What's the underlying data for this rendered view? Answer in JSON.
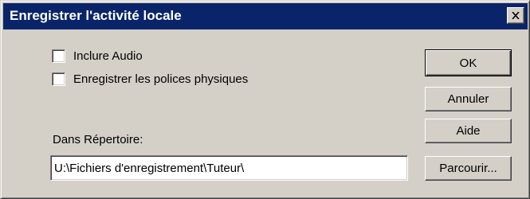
{
  "window": {
    "title": "Enregistrer l'activité locale",
    "close_icon": "close-icon"
  },
  "options": {
    "include_audio": {
      "label": "Inclure Audio",
      "checked": false
    },
    "record_fonts": {
      "label": "Enregistrer les polices physiques",
      "checked": false
    }
  },
  "directory": {
    "label": "Dans Répertoire:",
    "value": "U:\\Fichiers d'enregistrement\\Tuteur\\"
  },
  "buttons": {
    "ok": "OK",
    "cancel": "Annuler",
    "help": "Aide",
    "browse": "Parcourir..."
  }
}
